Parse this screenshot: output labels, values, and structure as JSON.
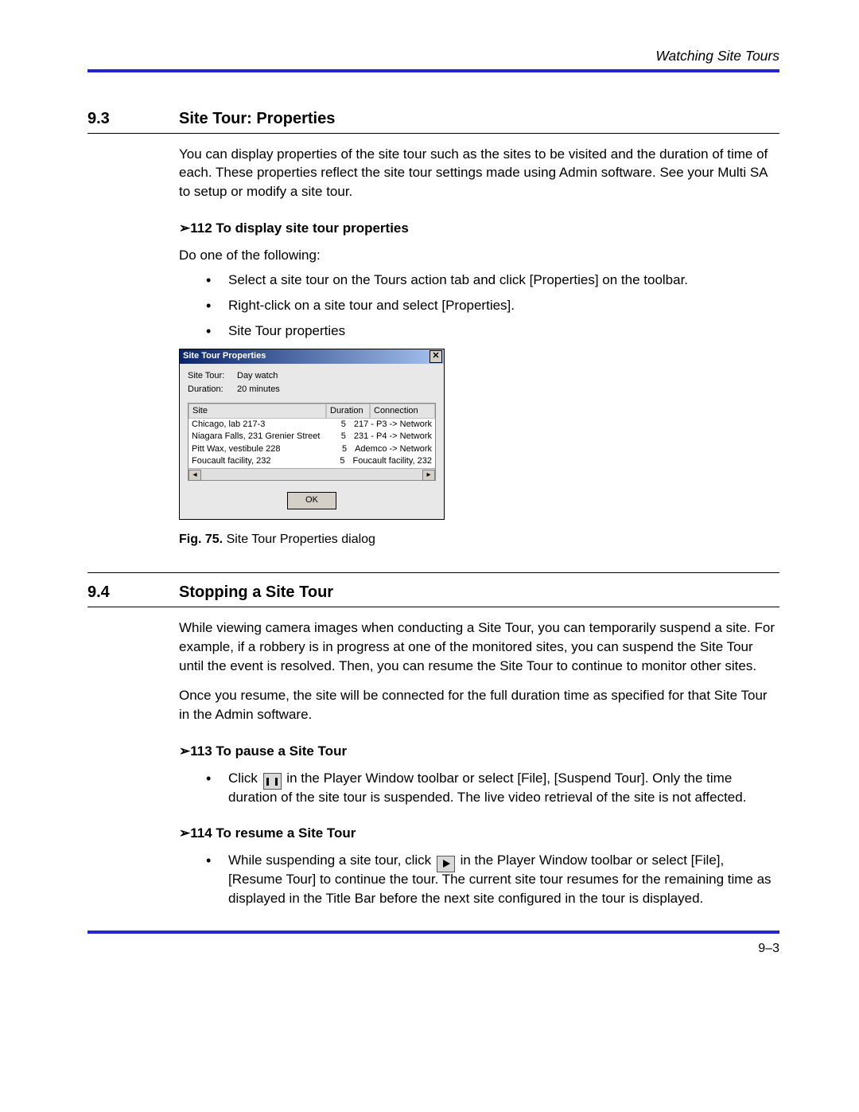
{
  "header": {
    "running_title": "Watching Site Tours"
  },
  "section93": {
    "num": "9.3",
    "title": "Site Tour: Properties",
    "intro": "You can display properties of the site tour such as the sites to be visited and the duration of time of each. These properties reflect the site tour settings made using Admin software. See your Multi SA to setup or modify a site tour.",
    "proc_heading": "➢112  To display site tour properties",
    "proc_intro": "Do one of the following:",
    "bullets": [
      "Select a site tour on the Tours action tab and click [Properties] on the toolbar.",
      "Right-click on a site tour and select [Properties].",
      "Site Tour properties"
    ],
    "fig_label": "Fig. 75.",
    "fig_text": " Site Tour Properties dialog"
  },
  "dialog": {
    "title": "Site Tour Properties",
    "site_tour_label": "Site Tour:",
    "site_tour_value": "Day watch",
    "duration_label": "Duration:",
    "duration_value": "20 minutes",
    "ok": "OK",
    "columns": {
      "c1": "Site",
      "c2": "Duration",
      "c3": "Connection"
    },
    "rows": [
      {
        "site": "Chicago, lab 217-3",
        "dur": "5",
        "conn": "217 - P3 -> Network"
      },
      {
        "site": "Niagara Falls, 231 Grenier Street",
        "dur": "5",
        "conn": "231 - P4 -> Network"
      },
      {
        "site": "Pitt Wax, vestibule 228",
        "dur": "5",
        "conn": "Ademco -> Network"
      },
      {
        "site": "Foucault facility, 232",
        "dur": "5",
        "conn": "Foucault facility, 232"
      }
    ]
  },
  "section94": {
    "num": "9.4",
    "title": "Stopping a Site Tour",
    "para1": "While viewing camera images when conducting a Site Tour, you can temporarily suspend a site. For example, if a robbery is in progress at one of the monitored sites, you can suspend the Site Tour until the event is resolved. Then, you can resume the Site Tour to continue to monitor other sites.",
    "para2": "Once you resume, the site will be connected for the full duration time as specified for that Site Tour in the Admin software.",
    "proc113": "➢113  To pause a Site Tour",
    "b113a": "Click ",
    "b113b": " in the Player Window toolbar or select [File], [Suspend Tour]. Only the time duration of the site tour is suspended. The live video retrieval of the site is not affected.",
    "proc114": "➢114  To resume a Site Tour",
    "b114a": "While suspending a site tour, click ",
    "b114b": " in the Player Window toolbar or select [File], [Resume Tour] to continue the tour. The current site tour resumes for the remaining time as displayed in the Title Bar before the next site configured in the tour is displayed."
  },
  "footer": {
    "page_num": "9–3"
  }
}
